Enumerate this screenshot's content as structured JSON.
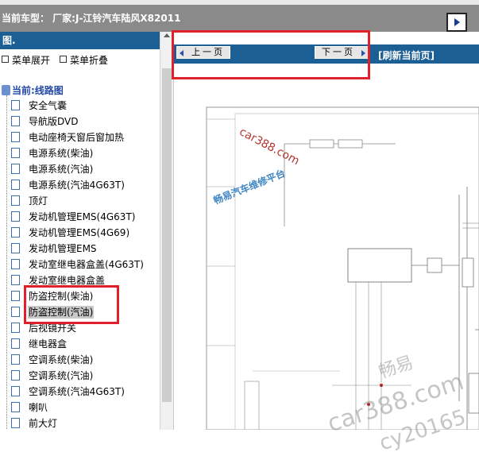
{
  "header": {
    "title": "当前车型： 厂家:J-江铃汽车陆风X82011",
    "expand_icon": "expand-arrow-icon"
  },
  "sidebar": {
    "panel_title": "图.",
    "expand_all": "菜单展开",
    "collapse_all": "菜单折叠",
    "current": "当前:线路图",
    "items": [
      {
        "label": "安全气囊"
      },
      {
        "label": "导航版DVD"
      },
      {
        "label": "电动座椅天窗后窗加热"
      },
      {
        "label": "电源系统(柴油)"
      },
      {
        "label": "电源系统(汽油)"
      },
      {
        "label": "电源系统(汽油4G63T)"
      },
      {
        "label": "顶灯"
      },
      {
        "label": "发动机管理EMS(4G63T)"
      },
      {
        "label": "发动机管理EMS(4G69)"
      },
      {
        "label": "发动机管理EMS"
      },
      {
        "label": "发动室继电器盒盖(4G63T)"
      },
      {
        "label": "发动室继电器盒盖"
      },
      {
        "label": "防盗控制(柴油)"
      },
      {
        "label": "防盗控制(汽油)"
      },
      {
        "label": "后视镜开关"
      },
      {
        "label": "继电器盒"
      },
      {
        "label": "空调系统(柴油)"
      },
      {
        "label": "空调系统(汽油)"
      },
      {
        "label": "空调系统(汽油4G63T)"
      },
      {
        "label": "喇叭"
      },
      {
        "label": "前大灯"
      }
    ],
    "selected_index": 13
  },
  "toolbar": {
    "prev_label": "上一页",
    "next_label": "下一页",
    "refresh_label": "[刷新当前页]"
  },
  "watermarks": {
    "site": "car388.com",
    "platform": "畅易汽车维修平台",
    "brand": "畅易",
    "site_large": "car388.com",
    "code": "cy20165"
  },
  "colors": {
    "header_bg": "#8a8a8a",
    "nav_bg": "#1c5f95",
    "highlight_box": "#e0202a",
    "selected_bg": "#c8c8c8"
  }
}
